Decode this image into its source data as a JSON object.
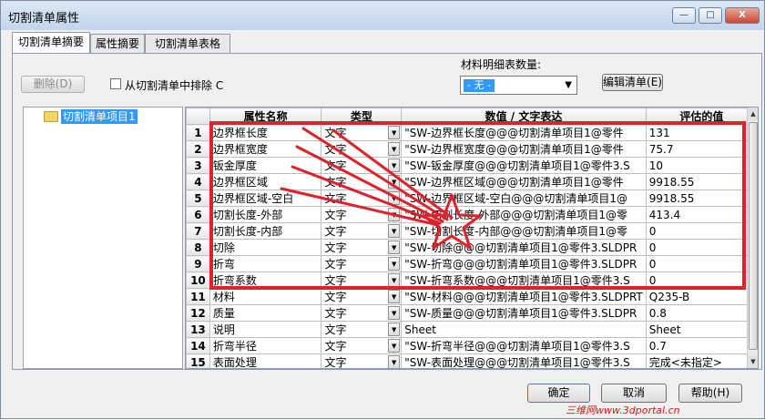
{
  "window": {
    "title": "切割清单属性",
    "controls": {
      "minimize": "—",
      "maximize": "□",
      "close": "X"
    }
  },
  "tabs": [
    "切割清单摘要",
    "属性摘要",
    "切割清单表格"
  ],
  "toolbar": {
    "delete_label": "删除(D)",
    "exclude_label": "从切割清单中排除 C",
    "bom_quantity_label": "材料明细表数量:",
    "bom_quantity_value": "- 无 -",
    "edit_list_label": "编辑清单(E)"
  },
  "tree": {
    "item": "切割清单项目1"
  },
  "grid": {
    "columns": [
      "",
      "属性名称",
      "类型",
      "数值 / 文字表达",
      "评估的值"
    ],
    "rows": [
      {
        "num": "1",
        "name": "边界框长度",
        "type": "文字",
        "expr": "\"SW-边界框长度@@@切割清单项目1@零件",
        "value": "131"
      },
      {
        "num": "2",
        "name": "边界框宽度",
        "type": "文字",
        "expr": "\"SW-边界框宽度@@@切割清单项目1@零件",
        "value": "75.7"
      },
      {
        "num": "3",
        "name": "钣金厚度",
        "type": "文字",
        "expr": "\"SW-钣金厚度@@@切割清单项目1@零件3.S",
        "value": "10"
      },
      {
        "num": "4",
        "name": "边界框区域",
        "type": "文字",
        "expr": "\"SW-边界框区域@@@切割清单项目1@零件",
        "value": "9918.55"
      },
      {
        "num": "5",
        "name": "边界框区域-空白",
        "type": "文字",
        "expr": "\"SW-边界框区域-空白@@@切割清单项目1@",
        "value": "9918.55"
      },
      {
        "num": "6",
        "name": "切割长度-外部",
        "type": "文字",
        "expr": "\"SW-切割长度-外部@@@切割清单项目1@零",
        "value": "413.4"
      },
      {
        "num": "7",
        "name": "切割长度-内部",
        "type": "文字",
        "expr": "\"SW-切割长度-内部@@@切割清单项目1@零",
        "value": "0"
      },
      {
        "num": "8",
        "name": "切除",
        "type": "文字",
        "expr": "\"SW-切除@@@切割清单项目1@零件3.SLDPR",
        "value": "0"
      },
      {
        "num": "9",
        "name": "折弯",
        "type": "文字",
        "expr": "\"SW-折弯@@@切割清单项目1@零件3.SLDPR",
        "value": "0"
      },
      {
        "num": "10",
        "name": "折弯系数",
        "type": "文字",
        "expr": "\"SW-折弯系数@@@切割清单项目1@零件3.S",
        "value": "0"
      },
      {
        "num": "11",
        "name": "材料",
        "type": "文字",
        "expr": "\"SW-材料@@@切割清单项目1@零件3.SLDPRT",
        "value": "Q235-B"
      },
      {
        "num": "12",
        "name": "质量",
        "type": "文字",
        "expr": "\"SW-质量@@@切割清单项目1@零件3.SLDPR",
        "value": "0.8"
      },
      {
        "num": "13",
        "name": "说明",
        "type": "文字",
        "expr": "Sheet",
        "value": "Sheet"
      },
      {
        "num": "14",
        "name": "折弯半径",
        "type": "文字",
        "expr": "\"SW-折弯半径@@@切割清单项目1@零件3.S",
        "value": "0.7"
      },
      {
        "num": "15",
        "name": "表面处理",
        "type": "文字",
        "expr": "\"SW-表面处理@@@切割清单项目1@零件3.S",
        "value": "完成<未指定>"
      }
    ]
  },
  "footer": {
    "ok_label": "确定",
    "cancel_label": "取消",
    "help_label": "帮助(H)"
  },
  "watermark": "三维网www.3dportal.cn",
  "annotation_color": "#e0202a"
}
